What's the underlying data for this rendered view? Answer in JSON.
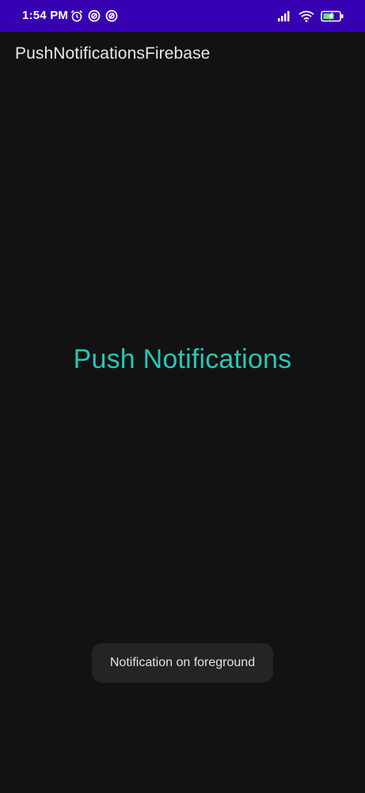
{
  "status_bar": {
    "time": "1:54 PM",
    "icons_left": [
      "alarm-icon",
      "target-icon",
      "target-icon"
    ],
    "icons_right": [
      "signal-icon",
      "wifi-icon",
      "battery-charging-icon"
    ],
    "background_color": "#3700b3"
  },
  "app_bar": {
    "title": "PushNotificationsFirebase"
  },
  "main": {
    "heading": "Push Notifications",
    "heading_color": "#26c6b8"
  },
  "toast": {
    "message": "Notification on foreground"
  }
}
